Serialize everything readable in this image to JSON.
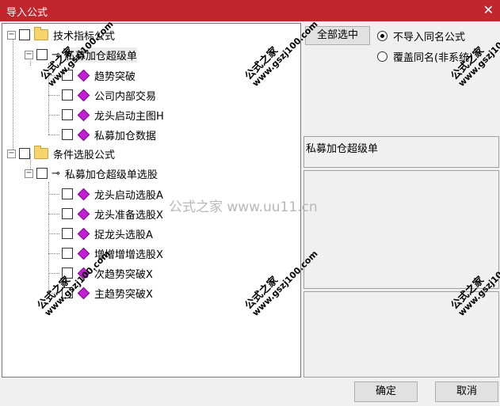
{
  "window": {
    "title": "导入公式",
    "close_glyph": "✕"
  },
  "tree": {
    "groups": [
      {
        "label": "技术指标公式",
        "children": [
          {
            "label": "私募加仓超级单",
            "items": [
              "趋势突破",
              "公司内部交易",
              "龙头启动主图H",
              "私募加仓数据"
            ]
          }
        ]
      },
      {
        "label": "条件选股公式",
        "children": [
          {
            "label": "私募加仓超级单选股",
            "items": [
              "龙头启动选股A",
              "龙头准备选股X",
              "捉龙头选股A",
              "增增增增选股X",
              "次趋势突破X",
              "主趋势突破X"
            ]
          }
        ]
      }
    ]
  },
  "right": {
    "select_all": "全部选中",
    "radio_skip": "不导入同名公式",
    "radio_overwrite": "覆盖同名(非系统)",
    "info_title": "私募加仓超级单"
  },
  "buttons": {
    "ok": "确定",
    "cancel": "取消"
  },
  "watermark": {
    "center": "公式之家 www.uu11.cn",
    "stamp_cn": "公式之家",
    "stamp_url": "www.gszj100.com"
  },
  "colors": {
    "titlebar": "#c0262b",
    "gem": "#c21fd4",
    "folder": "#f7d36b"
  }
}
